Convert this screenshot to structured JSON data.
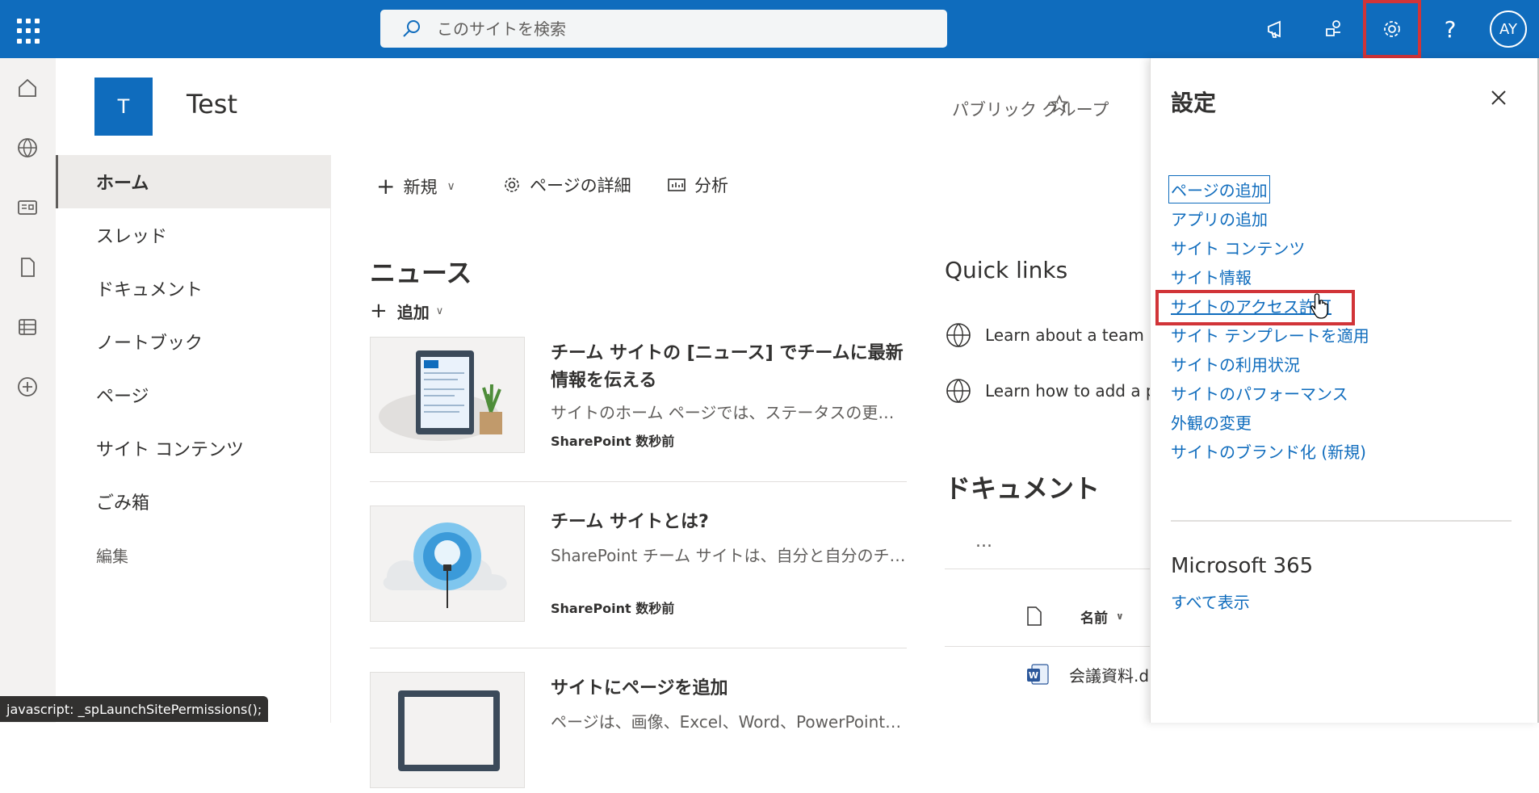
{
  "topbar": {
    "search_placeholder": "このサイトを検索",
    "avatar_initials": "AY",
    "icons": [
      "waffle-icon",
      "search-icon",
      "megaphone-icon",
      "share-icon",
      "gear-icon",
      "help-icon"
    ],
    "accent_color": "#0f6cbd",
    "highlight_color": "#d13438"
  },
  "site": {
    "logo_letter": "T",
    "title": "Test",
    "group_label": "パブリック グループ"
  },
  "nav": {
    "items": [
      {
        "label": "ホーム"
      },
      {
        "label": "スレッド"
      },
      {
        "label": "ドキュメント"
      },
      {
        "label": "ノートブック"
      },
      {
        "label": "ページ"
      },
      {
        "label": "サイト コンテンツ"
      },
      {
        "label": "ごみ箱"
      },
      {
        "label": "編集"
      }
    ]
  },
  "cmdbar": {
    "new_label": "新規",
    "page_details_label": "ページの詳細",
    "analytics_label": "分析"
  },
  "news": {
    "title": "ニュース",
    "add_label": "追加",
    "items": [
      {
        "title": "チーム サイトの [ニュース] でチームに最新情報を伝える",
        "desc": "サイトのホーム ページでは、ステータスの更新…",
        "meta": "SharePoint 数秒前"
      },
      {
        "title": "チーム サイトとは?",
        "desc": "SharePoint チーム サイトは、自分と自分のチ…",
        "meta": "SharePoint 数秒前"
      },
      {
        "title": "サイトにページを追加",
        "desc": "ページは、画像、Excel、Word、PowerPoint、…",
        "meta": ""
      }
    ]
  },
  "quicklinks": {
    "title": "Quick links",
    "items": [
      {
        "label": "Learn about a team s"
      },
      {
        "label": "Learn how to add a p"
      }
    ]
  },
  "documents": {
    "title": "ドキュメント",
    "more": "...",
    "col_name": "名前",
    "rows": [
      {
        "name": "会議資料.d"
      }
    ]
  },
  "settings_panel": {
    "title": "設定",
    "links": [
      {
        "label": "ページの追加"
      },
      {
        "label": "アプリの追加"
      },
      {
        "label": "サイト コンテンツ"
      },
      {
        "label": "サイト情報"
      },
      {
        "label": "サイトのアクセス許可"
      },
      {
        "label": "サイト テンプレートを適用"
      },
      {
        "label": "サイトの利用状況"
      },
      {
        "label": "サイトのパフォーマンス"
      },
      {
        "label": "外観の変更"
      },
      {
        "label": "サイトのブランド化 (新規)"
      }
    ],
    "m365_title": "Microsoft 365",
    "see_all": "すべて表示"
  },
  "statusbar": {
    "text": "javascript: _spLaunchSitePermissions();"
  }
}
